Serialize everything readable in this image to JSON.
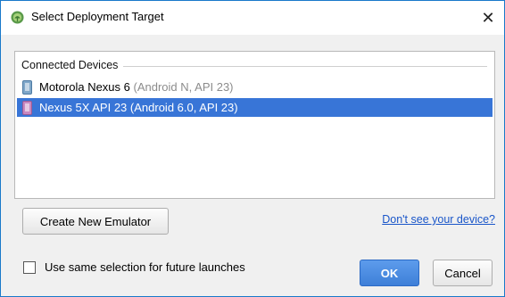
{
  "window": {
    "title": "Select Deployment Target",
    "app_icon": "android-studio-icon",
    "close_label": "✕"
  },
  "device_list": {
    "section_title": "Connected Devices",
    "devices": [
      {
        "name": "Motorola Nexus 6",
        "detail": "(Android N, API 23)",
        "icon": "phone-icon",
        "selected": false
      },
      {
        "name": "Nexus 5X API 23",
        "detail": "(Android 6.0, API 23)",
        "icon": "emulator-phone-icon",
        "selected": true
      }
    ]
  },
  "actions": {
    "create_emulator_label": "Create New Emulator",
    "help_link_label": "Don't see your device?"
  },
  "footer": {
    "checkbox_label": "Use same selection for future launches",
    "checkbox_checked": false,
    "ok_label": "OK",
    "cancel_label": "Cancel"
  },
  "colors": {
    "selection": "#3875d7",
    "primary_button": "#4a8be0",
    "link": "#1a56c9"
  }
}
